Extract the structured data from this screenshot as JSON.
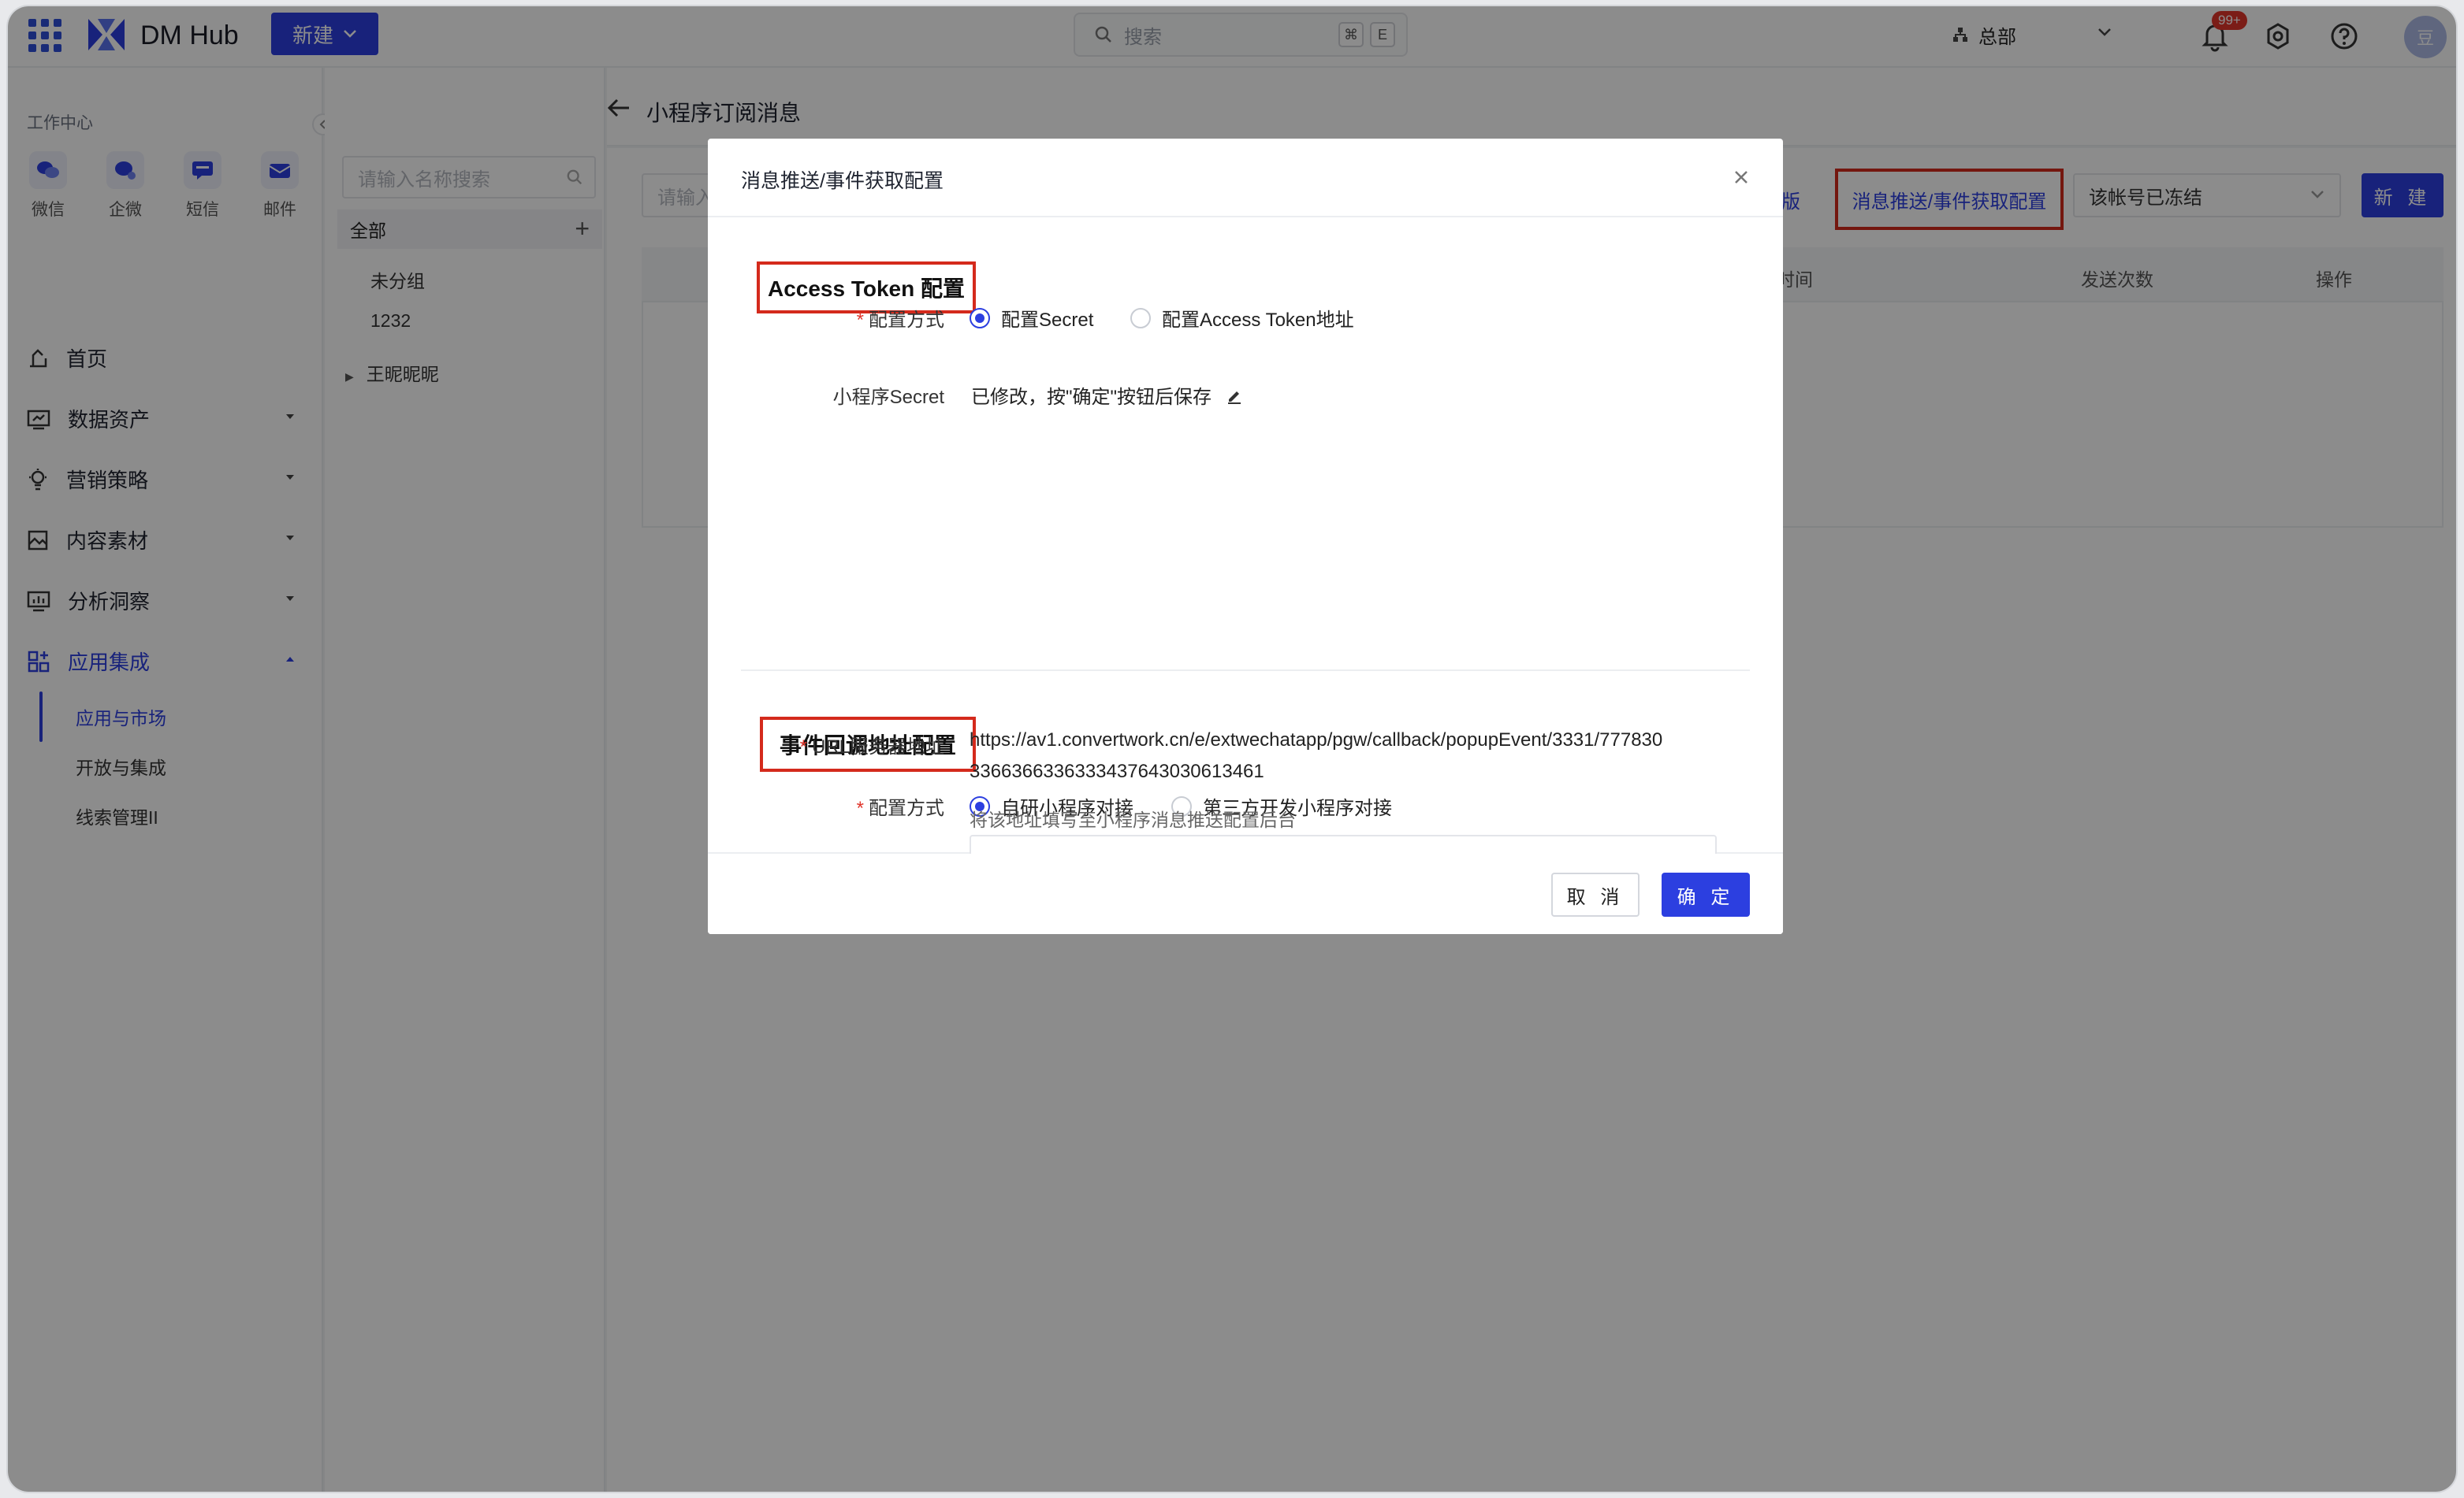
{
  "topbar": {
    "brand": "DM Hub",
    "new_label": "新建",
    "search_placeholder": "搜索",
    "kbd_cmd": "⌘",
    "kbd_e": "E",
    "org_label": "总部",
    "notify_badge": "99+",
    "avatar_text": "豆"
  },
  "sidebar": {
    "section_title": "工作中心",
    "channels": [
      {
        "label": "微信",
        "icon": "wechat-icon"
      },
      {
        "label": "企微",
        "icon": "wecom-icon"
      },
      {
        "label": "短信",
        "icon": "sms-icon"
      },
      {
        "label": "邮件",
        "icon": "email-icon"
      }
    ],
    "nav": [
      {
        "label": "首页",
        "icon": "home-icon"
      },
      {
        "label": "数据资产",
        "icon": "data-asset-icon"
      },
      {
        "label": "营销策略",
        "icon": "strategy-icon"
      },
      {
        "label": "内容素材",
        "icon": "content-icon"
      },
      {
        "label": "分析洞察",
        "icon": "analytics-icon"
      },
      {
        "label": "应用集成",
        "icon": "apps-icon"
      }
    ],
    "subnav": [
      "应用与市场",
      "开放与集成",
      "线索管理II"
    ]
  },
  "groups": {
    "search_placeholder": "请输入名称搜索",
    "all_label": "全部",
    "items": [
      "未分组",
      "1232",
      "王昵昵昵"
    ]
  },
  "page": {
    "title": "小程序订阅消息",
    "tpl_search_placeholder": "请输入",
    "link_tpl": "模版",
    "link_config": "消息推送/事件获取配置",
    "status_select": "该帐号已冻结",
    "new_label": "新 建",
    "table_headers": [
      "时间",
      "发送次数",
      "操作"
    ]
  },
  "modal": {
    "title": "消息推送/事件获取配置",
    "section1": "Access Token 配置",
    "config_mode_label": "配置方式",
    "s1_options": [
      "配置Secret",
      "配置Access Token地址"
    ],
    "secret_label": "小程序Secret",
    "secret_value": "已修改，按\"确定\"按钮后保存",
    "section2": "事件回调地址配置",
    "s2_options": [
      "自研小程序对接",
      "第三方开发小程序对接"
    ],
    "url_label": "URL服务器地址",
    "url_line1": "https://av1.convertwork.cn/e/extwechatapp/pgw/callback/popupEvent/3331/777830",
    "url_line2": "3366366336333437643030613461",
    "url_hint": "将该地址填写至小程序消息推送配置后台",
    "cancel": "取 消",
    "ok": "确 定"
  },
  "colors": {
    "primary": "#2c3fe0",
    "highlight_box": "#d42a1c",
    "required": "#e0352b"
  }
}
